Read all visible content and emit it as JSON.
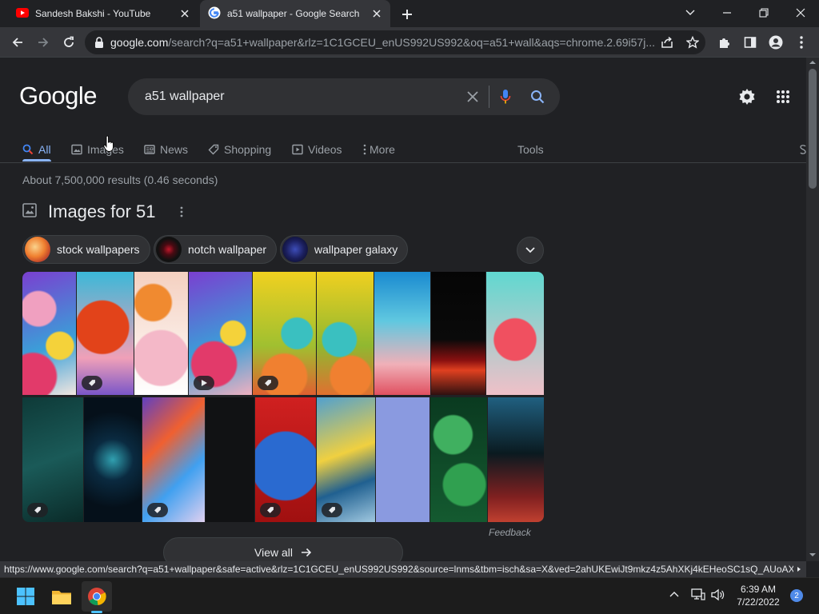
{
  "browser": {
    "tabs": [
      {
        "title": "Sandesh Bakshi - YouTube",
        "active": false,
        "icon": "youtube-icon"
      },
      {
        "title": "a51 wallpaper - Google Search",
        "active": true,
        "icon": "google-icon"
      }
    ],
    "url_host": "google.com",
    "url_rest": "/search?q=a51+wallpaper&rlz=1C1GCEU_enUS992US992&oq=a51+wall&aqs=chrome.2.69i57j..."
  },
  "google": {
    "logo": "Google",
    "query": "a51 wallpaper",
    "nav_tabs": [
      {
        "label": "All",
        "icon": "search-icon",
        "selected": true
      },
      {
        "label": "Images",
        "icon": "image-icon",
        "selected": false
      },
      {
        "label": "News",
        "icon": "news-icon",
        "selected": false
      },
      {
        "label": "Shopping",
        "icon": "tag-icon",
        "selected": false
      },
      {
        "label": "Videos",
        "icon": "video-icon",
        "selected": false
      },
      {
        "label": "More",
        "icon": "more-vert-icon",
        "selected": false
      }
    ],
    "tools_label": "Tools",
    "result_stats": "About 7,500,000 results (0.46 seconds)",
    "images_heading": "Images for 51",
    "chips": [
      {
        "label": "stock wallpapers"
      },
      {
        "label": "notch wallpaper"
      },
      {
        "label": "wallpaper galaxy"
      }
    ],
    "feedback_label": "Feedback",
    "view_all_label": "View all"
  },
  "status_url": "https://www.google.com/search?q=a51+wallpaper&safe=active&rlz=1C1GCEU_enUS992US992&source=lnms&tbm=isch&sa=X&ved=2ahUKEwiJt9mkz4z5AhXKj4kEHeoSC1sQ_AUoAX...",
  "taskbar": {
    "apps": [
      "windows-start",
      "file-explorer",
      "chrome"
    ],
    "time": "6:39 AM",
    "date": "7/22/2022",
    "notifications": "2"
  },
  "colors": {
    "background": "#202124",
    "accent": "#8ab4f8",
    "tab_active": "#35363a"
  }
}
